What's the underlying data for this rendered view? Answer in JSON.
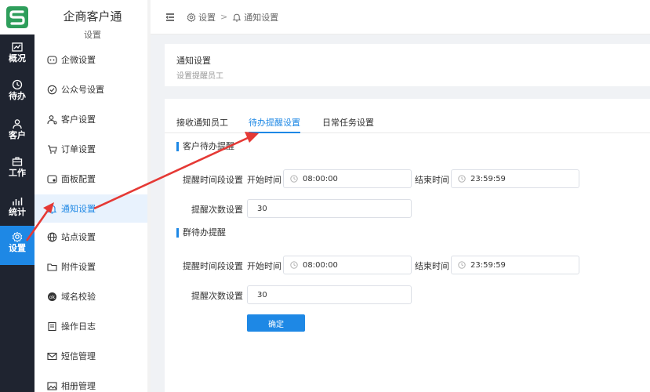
{
  "rail": {
    "items": [
      {
        "label": "概况",
        "icon": "chart-icon"
      },
      {
        "label": "待办",
        "icon": "history-icon"
      },
      {
        "label": "客户",
        "icon": "user-icon"
      },
      {
        "label": "工作",
        "icon": "briefcase-icon"
      },
      {
        "label": "统计",
        "icon": "stats-icon"
      },
      {
        "label": "设置",
        "icon": "gear-icon",
        "active": true
      }
    ]
  },
  "sidebar": {
    "title": "企商客户通",
    "subtitle": "设置",
    "items": [
      {
        "label": "企微设置"
      },
      {
        "label": "公众号设置"
      },
      {
        "label": "客户设置"
      },
      {
        "label": "订单设置"
      },
      {
        "label": "面板配置"
      },
      {
        "label": "通知设置",
        "active": true
      },
      {
        "label": "站点设置"
      },
      {
        "label": "附件设置"
      },
      {
        "label": "域名校验"
      },
      {
        "label": "操作日志"
      },
      {
        "label": "短信管理"
      },
      {
        "label": "相册管理"
      }
    ]
  },
  "breadcrumb": {
    "first": "设置",
    "separator": ">",
    "second": "通知设置"
  },
  "header": {
    "title": "通知设置",
    "subtitle": "设置提醒员工"
  },
  "tabs": [
    {
      "label": "接收通知员工"
    },
    {
      "label": "待办提醒设置",
      "active": true
    },
    {
      "label": "日常任务设置"
    }
  ],
  "customer_section": {
    "title": "客户待办提醒",
    "period_label": "提醒时间段设置",
    "start_label": "开始时间",
    "start_value": "08:00:00",
    "end_label": "结束时间",
    "end_value": "23:59:59",
    "count_label": "提醒次数设置",
    "count_value": "30"
  },
  "group_section": {
    "title": "群待办提醒",
    "period_label": "提醒时间段设置",
    "start_label": "开始时间",
    "start_value": "08:00:00",
    "end_label": "结束时间",
    "end_value": "23:59:59",
    "count_label": "提醒次数设置",
    "count_value": "30"
  },
  "confirm_label": "确定",
  "colors": {
    "accent": "#1e88e5",
    "rail_bg": "#1f2430",
    "annotation_arrow": "#e53935"
  }
}
